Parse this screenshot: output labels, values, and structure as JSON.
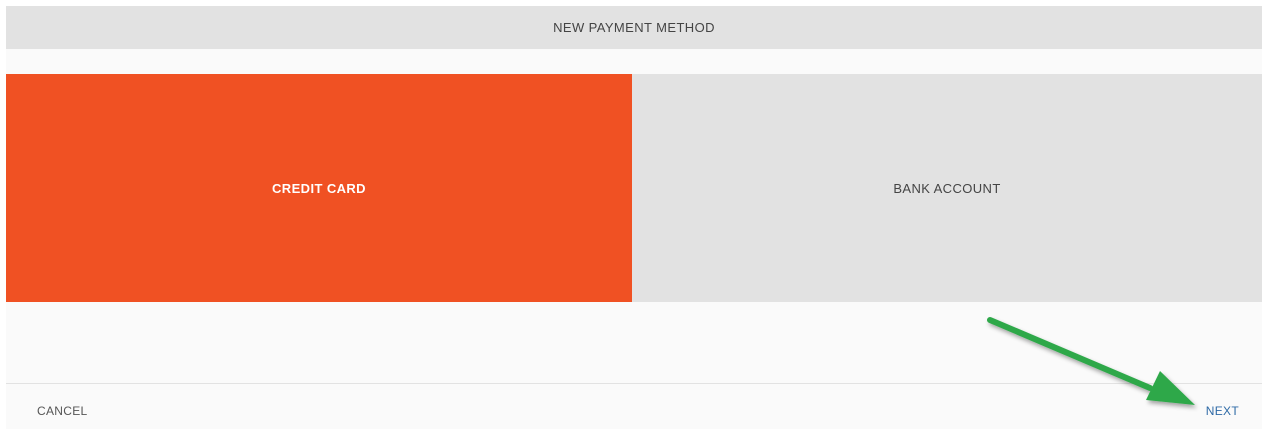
{
  "dialog": {
    "title": "NEW PAYMENT METHOD"
  },
  "methods": [
    {
      "label": "CREDIT CARD",
      "selected": true
    },
    {
      "label": "BANK ACCOUNT",
      "selected": false
    }
  ],
  "footer": {
    "cancel_label": "CANCEL",
    "next_label": "NEXT"
  },
  "colors": {
    "accent": "#f05123",
    "inactive": "#e2e2e2",
    "link": "#2e6aa6",
    "annotation_arrow": "#2ea84a"
  }
}
